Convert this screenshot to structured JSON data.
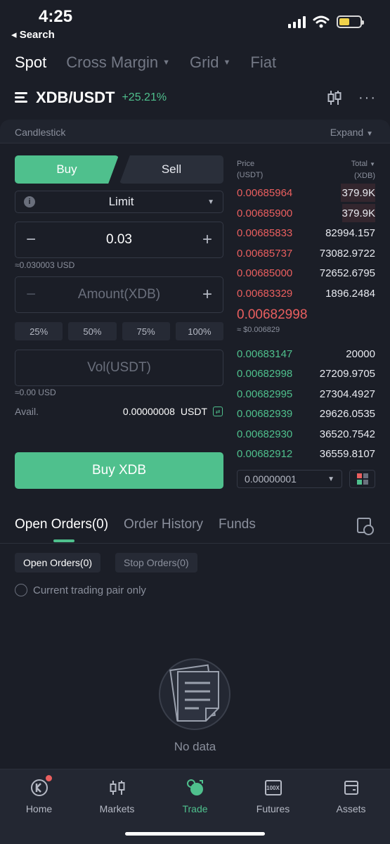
{
  "status_bar": {
    "time": "4:25",
    "back_label": "Search"
  },
  "top_tabs": [
    {
      "label": "Spot",
      "has_caret": false
    },
    {
      "label": "Cross Margin",
      "has_caret": true
    },
    {
      "label": "Grid",
      "has_caret": true
    },
    {
      "label": "Fiat",
      "has_caret": false
    }
  ],
  "pair": {
    "name": "XDB/USDT",
    "change": "+25.21%"
  },
  "chart_panel": {
    "label": "Candlestick",
    "expand": "Expand"
  },
  "trade_form": {
    "buy_tab": "Buy",
    "sell_tab": "Sell",
    "order_type": "Limit",
    "price_value": "0.03",
    "price_hint": "≈0.030003 USD",
    "amount_placeholder": "Amount(XDB)",
    "percents": [
      "25%",
      "50%",
      "75%",
      "100%"
    ],
    "vol_placeholder": "Vol(USDT)",
    "vol_hint": "≈0.00 USD",
    "avail_label": "Avail.",
    "avail_value": "0.00000008",
    "avail_unit": "USDT",
    "buy_button": "Buy XDB"
  },
  "order_book": {
    "price_header": "Price",
    "price_unit": "(USDT)",
    "total_header": "Total",
    "total_unit": "(XDB)",
    "asks": [
      {
        "price": "0.00685964",
        "total": "379.9K",
        "depth": 1.0
      },
      {
        "price": "0.00685900",
        "total": "379.9K",
        "depth": 0.95
      },
      {
        "price": "0.00685833",
        "total": "82994.157",
        "depth": 0
      },
      {
        "price": "0.00685737",
        "total": "73082.9722",
        "depth": 0
      },
      {
        "price": "0.00685000",
        "total": "72652.6795",
        "depth": 0
      },
      {
        "price": "0.00683329",
        "total": "1896.2484",
        "depth": 0
      }
    ],
    "last_price": "0.00682998",
    "last_price_usd": "≈ $0.006829",
    "bids": [
      {
        "price": "0.00683147",
        "total": "20000"
      },
      {
        "price": "0.00682998",
        "total": "27209.9705"
      },
      {
        "price": "0.00682995",
        "total": "27304.4927"
      },
      {
        "price": "0.00682939",
        "total": "29626.0535"
      },
      {
        "price": "0.00682930",
        "total": "36520.7542"
      },
      {
        "price": "0.00682912",
        "total": "36559.8107"
      }
    ],
    "precision": "0.00000001"
  },
  "orders": {
    "tabs": [
      "Open Orders(0)",
      "Order History",
      "Funds"
    ],
    "chips": [
      "Open Orders(0)",
      "Stop Orders(0)"
    ],
    "current_pair_only": "Current trading pair only",
    "empty_label": "No data"
  },
  "bottom_nav": [
    {
      "label": "Home",
      "icon": "home-icon"
    },
    {
      "label": "Markets",
      "icon": "markets-icon"
    },
    {
      "label": "Trade",
      "icon": "trade-icon"
    },
    {
      "label": "Futures",
      "icon": "futures-icon",
      "icon_text": "100X"
    },
    {
      "label": "Assets",
      "icon": "assets-icon"
    }
  ],
  "colors": {
    "buy": "#4fc08d",
    "sell": "#ea5f5f",
    "background": "#1b1e27"
  }
}
